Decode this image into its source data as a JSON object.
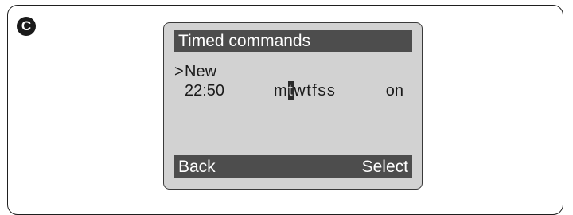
{
  "figure": {
    "badge_label": "C"
  },
  "screen": {
    "title": "Timed commands",
    "cursor": ">",
    "menu_item": "New",
    "entry": {
      "time": "22:50",
      "days": [
        {
          "letter": "m",
          "selected": false
        },
        {
          "letter": "t",
          "selected": true
        },
        {
          "letter": "w",
          "selected": false
        },
        {
          "letter": "t",
          "selected": false
        },
        {
          "letter": "f",
          "selected": false
        },
        {
          "letter": "s",
          "selected": false
        },
        {
          "letter": "s",
          "selected": false
        }
      ],
      "state": "on"
    },
    "softkeys": {
      "left": "Back",
      "right": "Select"
    }
  },
  "colors": {
    "lcd_background": "#d2d2d2",
    "bar_background": "#4d4d4d",
    "highlight": "#2a2a2a"
  }
}
